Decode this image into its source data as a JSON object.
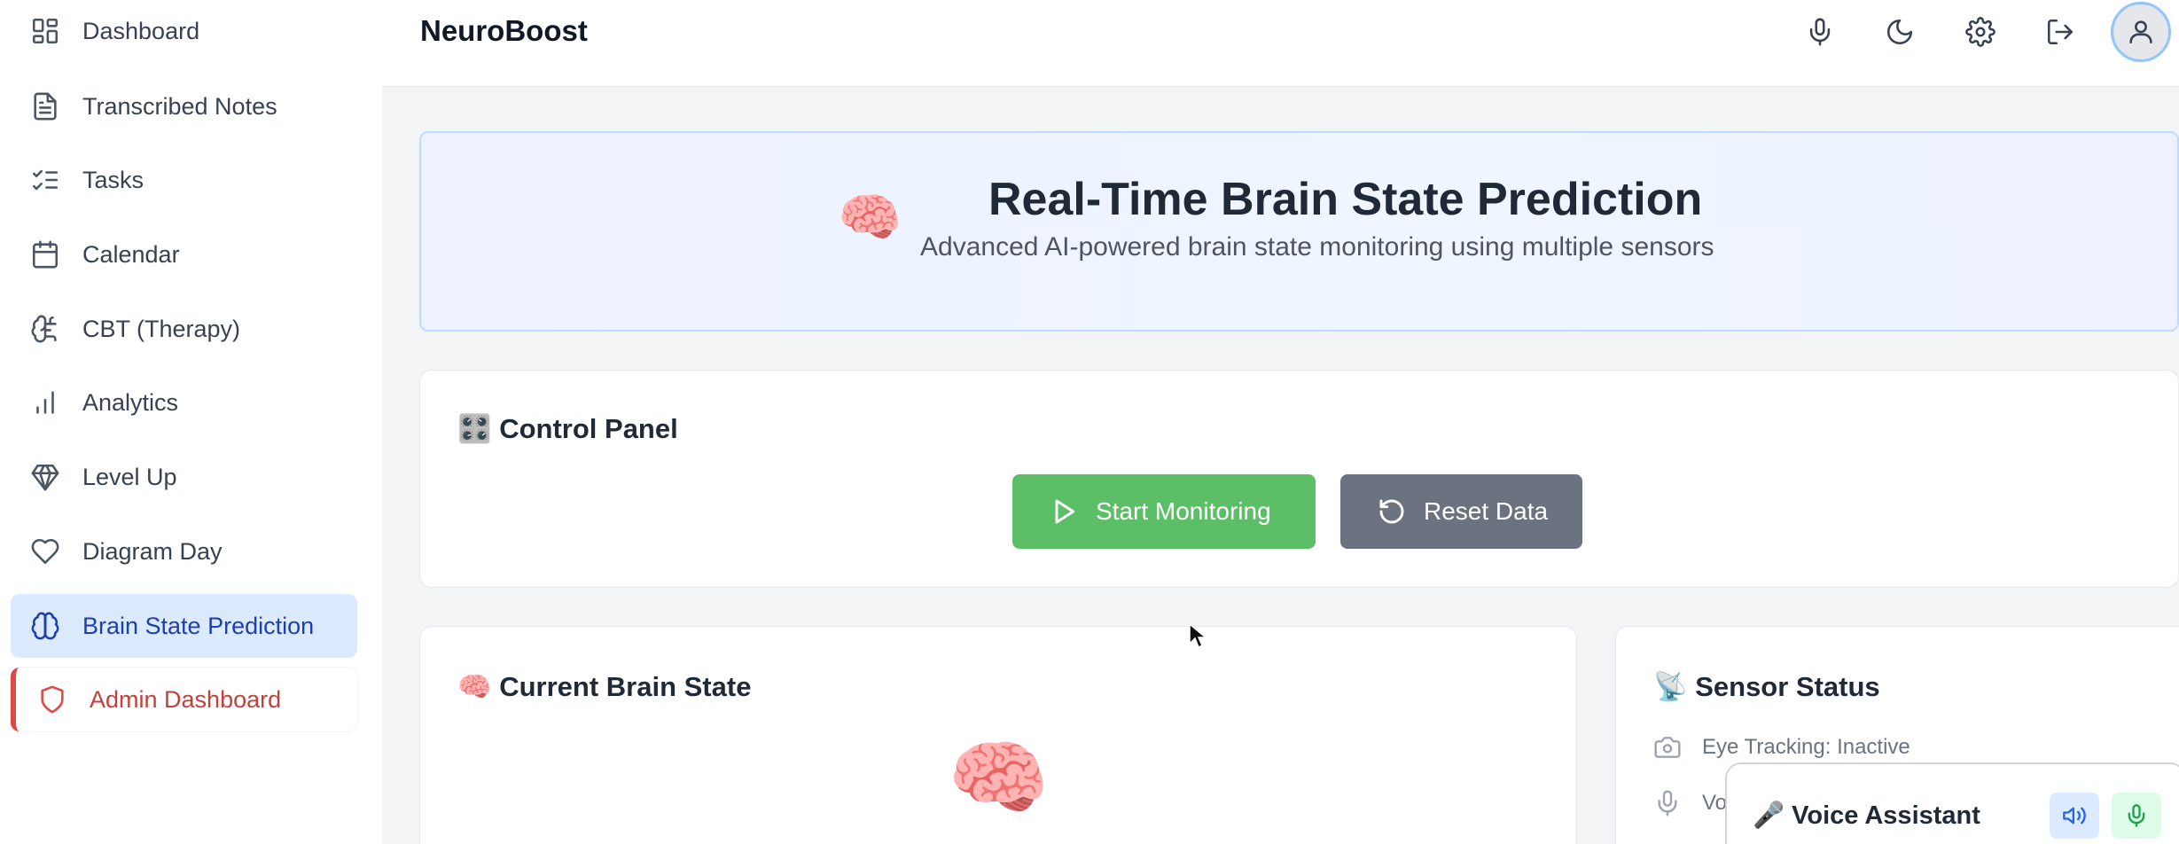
{
  "app": {
    "brand": "NeuroBoost"
  },
  "sidebar": {
    "items": [
      {
        "label": "Dashboard",
        "icon": "dashboard-icon"
      },
      {
        "label": "Transcribed Notes",
        "icon": "file-text-icon"
      },
      {
        "label": "Tasks",
        "icon": "list-checks-icon"
      },
      {
        "label": "Calendar",
        "icon": "calendar-icon"
      },
      {
        "label": "CBT (Therapy)",
        "icon": "brain-circuit-icon"
      },
      {
        "label": "Analytics",
        "icon": "bar-chart-icon"
      },
      {
        "label": "Level Up",
        "icon": "gem-icon"
      },
      {
        "label": "Diagram Day",
        "icon": "heart-icon"
      },
      {
        "label": "Brain State Prediction",
        "icon": "brain-icon",
        "active": true
      },
      {
        "label": "Admin Dashboard",
        "icon": "shield-icon"
      }
    ]
  },
  "header": {
    "icons": [
      "microphone-icon",
      "moon-icon",
      "settings-icon",
      "logout-icon",
      "user-icon"
    ]
  },
  "hero": {
    "emoji": "🧠",
    "title": "Real-Time Brain State Prediction",
    "subtitle": "Advanced AI-powered brain state monitoring using multiple sensors"
  },
  "control_panel": {
    "title": "🎛️ Control Panel",
    "start_label": "Start Monitoring",
    "reset_label": "Reset Data"
  },
  "brain_state": {
    "title": "🧠 Current Brain State",
    "emoji": "🧠"
  },
  "sensor_status": {
    "title": "📡 Sensor Status",
    "rows": [
      {
        "text": "Eye Tracking: Inactive",
        "icon": "camera-icon"
      },
      {
        "text": "Vo",
        "icon": "microphone-icon"
      }
    ]
  },
  "voice_assistant": {
    "title": "🎤 Voice Assistant"
  },
  "colors": {
    "accent_blue": "#1e40af",
    "start_green": "#5cbf68",
    "reset_gray": "#6b7280",
    "admin_red": "#dc4a43"
  }
}
